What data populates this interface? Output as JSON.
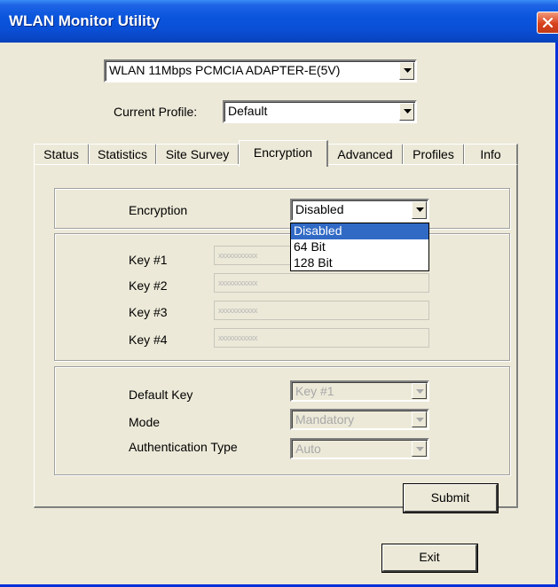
{
  "window": {
    "title": "WLAN Monitor Utility"
  },
  "adapter": {
    "selected": "WLAN 11Mbps PCMCIA ADAPTER-E(5V)"
  },
  "profile": {
    "label": "Current Profile:",
    "selected": "Default"
  },
  "tabs": [
    {
      "label": "Status"
    },
    {
      "label": "Statistics"
    },
    {
      "label": "Site Survey"
    },
    {
      "label": "Encryption"
    },
    {
      "label": "Advanced"
    },
    {
      "label": "Profiles"
    },
    {
      "label": "Info"
    }
  ],
  "active_tab": "Encryption",
  "encryption": {
    "label": "Encryption",
    "selected": "Disabled",
    "options": [
      "Disabled",
      "64 Bit",
      "128 Bit"
    ]
  },
  "keys": [
    {
      "label": "Key #1",
      "value": "xxxxxxxxxxx"
    },
    {
      "label": "Key #2",
      "value": "xxxxxxxxxxx"
    },
    {
      "label": "Key #3",
      "value": "xxxxxxxxxxx"
    },
    {
      "label": "Key #4",
      "value": "xxxxxxxxxxx"
    }
  ],
  "settings": {
    "default_key": {
      "label": "Default Key",
      "value": "Key #1"
    },
    "mode": {
      "label": "Mode",
      "value": "Mandatory"
    },
    "auth_type": {
      "label": "Authentication Type",
      "value": "Auto"
    }
  },
  "buttons": {
    "submit": "Submit",
    "exit": "Exit"
  },
  "colors": {
    "titlebar": "#0a4fd6",
    "close_button": "#d8421d",
    "selection": "#316ac5",
    "face": "#ece9d8"
  },
  "icons": [
    "close-icon",
    "chevron-down-icon"
  ]
}
